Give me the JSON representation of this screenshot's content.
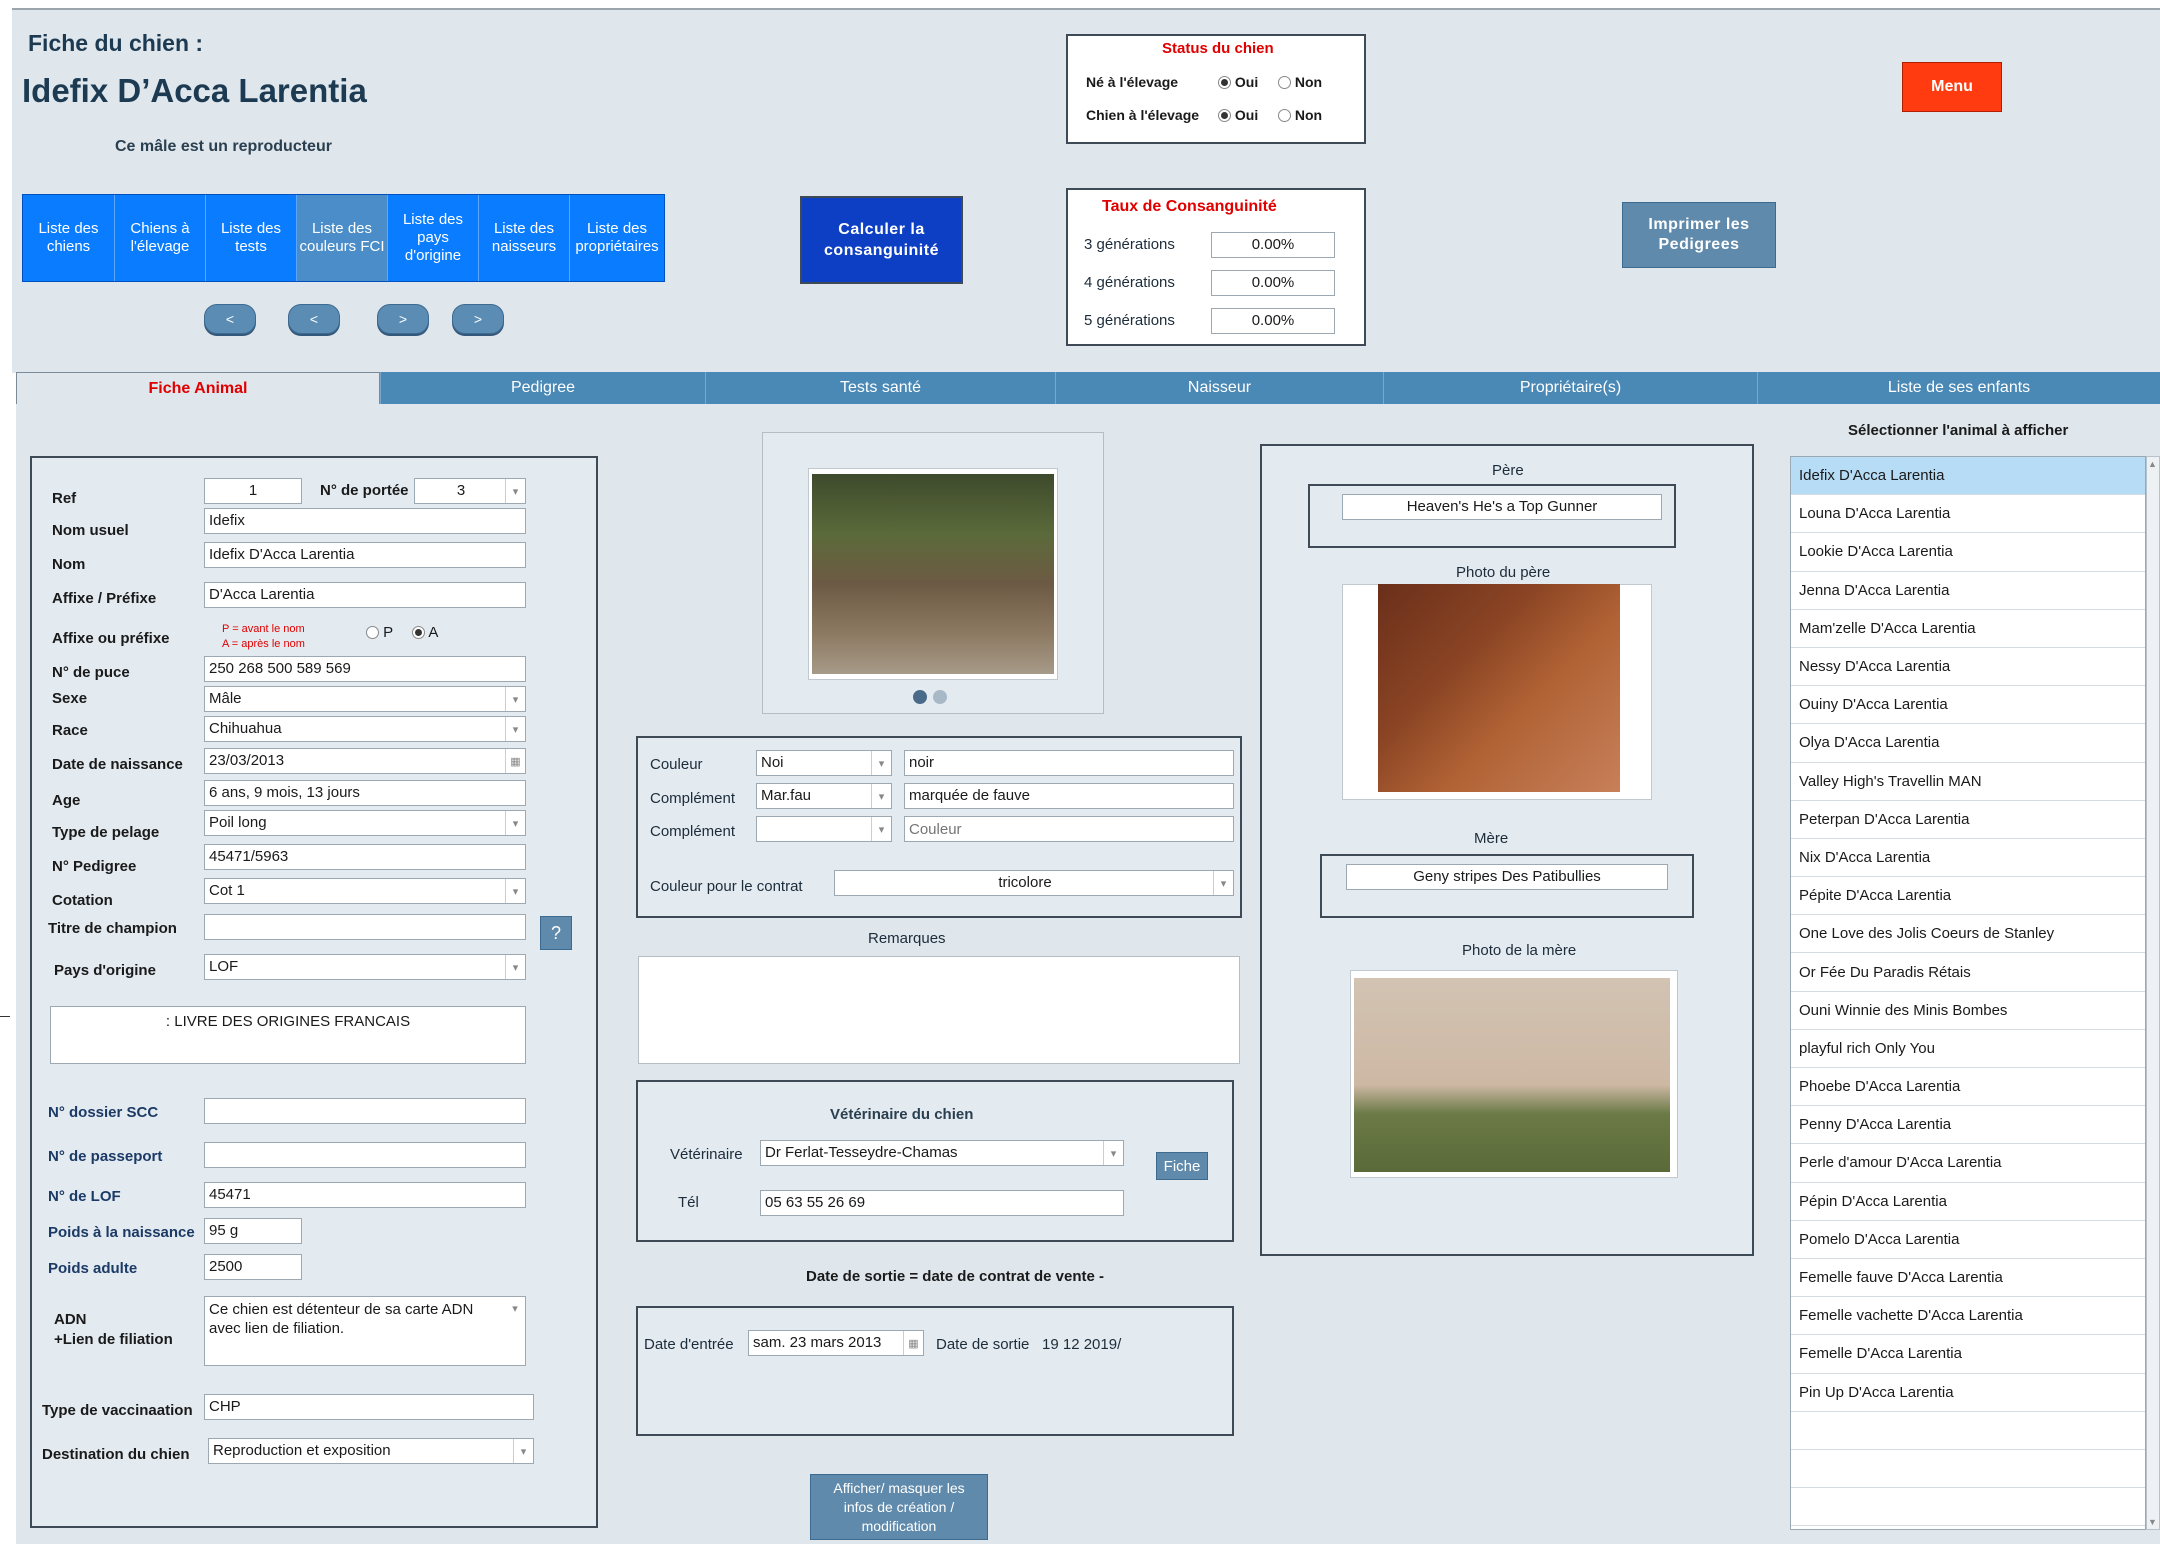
{
  "header": {
    "title": "Fiche du chien :",
    "dog_name": "Idefix  D’Acca Larentia",
    "subtitle": "Ce mâle est un reproducteur",
    "menu_label": "Menu"
  },
  "status": {
    "title": "Status du chien",
    "ne_label": "Né à l'élevage",
    "chien_label": "Chien à l'élevage",
    "oui": "Oui",
    "non": "Non"
  },
  "nav_buttons": [
    "Liste des chiens",
    "Chiens à l'élevage",
    "Liste des tests",
    "Liste des couleurs FCI",
    "Liste des pays d'origine",
    "Liste des naisseurs",
    "Liste des propriétaires"
  ],
  "nav_arrows": [
    "<",
    "<",
    ">",
    ">"
  ],
  "calc_button": "Calculer la consanguinité",
  "consanguinite": {
    "title": "Taux de Consanguinité",
    "rows": [
      {
        "label": "3 générations",
        "value": "0.00%"
      },
      {
        "label": "4 générations",
        "value": "0.00%"
      },
      {
        "label": "5 générations",
        "value": "0.00%"
      }
    ]
  },
  "print_button": "Imprimer les Pedigrees",
  "tabs": [
    "Fiche Animal",
    "Pedigree",
    "Tests santé",
    "Naisseur",
    "Propriétaire(s)",
    "Liste de ses enfants"
  ],
  "form": {
    "ref_label": "Ref",
    "ref_value": "1",
    "portee_label": "N° de portée",
    "portee_value": "3",
    "nom_usuel_label": "Nom usuel",
    "nom_usuel_value": "Idefix",
    "nom_label": "Nom",
    "nom_value": "Idefix  D'Acca Larentia",
    "affixe_label": "Affixe / Préfixe",
    "affixe_value": "D'Acca Larentia",
    "affixe_ou_label": "Affixe ou préfixe",
    "affixe_hint1": "P = avant le nom",
    "affixe_hint2": "A = après le nom",
    "opt_p": "P",
    "opt_a": "A",
    "puce_label": "N° de puce",
    "puce_value": "250 268 500 589 569",
    "sexe_label": "Sexe",
    "sexe_value": "Mâle",
    "race_label": "Race",
    "race_value": "Chihuahua",
    "naissance_label": "Date de naissance",
    "naissance_value": "23/03/2013",
    "age_label": "Age",
    "age_value": "6 ans, 9 mois, 13 jours",
    "pelage_label": "Type de pelage",
    "pelage_value": "Poil long",
    "pedigree_label": "N° Pedigree",
    "pedigree_value": "45471/5963",
    "cotation_label": "Cotation",
    "cotation_value": "Cot 1",
    "titre_label": "Titre de champion",
    "titre_value": "",
    "help": "?",
    "pays_label": "Pays d'origine",
    "pays_value": "LOF",
    "pays_desc": ": LIVRE DES ORIGINES FRANCAIS",
    "scc_label": "N° dossier SCC",
    "scc_value": "",
    "passeport_label": "N° de passeport",
    "passeport_value": "",
    "lof_label": "N° de LOF",
    "lof_value": "45471",
    "poids_naiss_label": "Poids à la naissance",
    "poids_naiss_value": "95 g",
    "poids_adulte_label": "Poids adulte",
    "poids_adulte_value": "2500",
    "adn_label1": "ADN",
    "adn_label2": "+Lien de filiation",
    "adn_value": "Ce chien est détenteur de sa carte ADN avec lien de filiation.",
    "vaccination_label": "Type de vaccinaation",
    "vaccination_value": "CHP",
    "destination_label": "Destination du chien",
    "destination_value": "Reproduction et exposition"
  },
  "couleur": {
    "couleur_label": "Couleur",
    "couleur_code": "Noi",
    "couleur_value": "noir",
    "complement_label": "Complément",
    "complement_code": "Mar.fau",
    "complement_value": "marquée de fauve",
    "complement2_label": "Complément",
    "complement2_code": "",
    "complement2_placeholder": "Couleur",
    "contrat_label": "Couleur pour le contrat",
    "contrat_value": "tricolore"
  },
  "remarques_label": "Remarques",
  "veterinaire": {
    "title": "Vétérinaire du chien",
    "vet_label": "Vétérinaire",
    "vet_value": "Dr Ferlat-Tesseydre-Chamas",
    "fiche_button": "Fiche",
    "tel_label": "Tél",
    "tel_value": "05 63 55 26 69"
  },
  "sortie_note": "Date de sortie = date de contrat de vente -",
  "dates": {
    "entree_label": "Date d'entrée",
    "entree_value": "sam. 23 mars 2013",
    "sortie_label": "Date de sortie",
    "sortie_value": "19 12 2019/"
  },
  "toggle_info_button": "Afficher/ masquer les infos de création / modification",
  "parents": {
    "pere_label": "Père",
    "pere_value": "Heaven's  He's a Top Gunner",
    "photo_pere_label": "Photo du père",
    "mere_label": "Mère",
    "mere_value": "Geny stripes   Des Patibullies",
    "photo_mere_label": "Photo de la mère"
  },
  "children": {
    "title": "Sélectionner l'animal à afficher",
    "items": [
      "Idefix  D'Acca Larentia",
      "Louna  D'Acca Larentia",
      "Lookie   D'Acca Larentia",
      "Jenna  D'Acca Larentia",
      "Mam'zelle   D'Acca Larentia",
      "Nessy   D'Acca Larentia",
      "Ouiny   D'Acca Larentia",
      "Olya  D'Acca Larentia",
      "Valley High's   Travellin MAN",
      "Peterpan  D'Acca Larentia",
      "Nix  D'Acca Larentia",
      "Pépite   D'Acca Larentia",
      "One Love  des Jolis Coeurs de Stanley",
      "Or Fée  Du Paradis Rétais",
      "Ouni Winnie   des Minis Bombes",
      "playful rich  Only You",
      "Phoebe  D'Acca Larentia",
      "Penny  D'Acca Larentia",
      "Perle d'amour  D'Acca Larentia",
      "Pépin  D'Acca Larentia",
      "Pomelo  D'Acca Larentia",
      "Femelle fauve  D'Acca Larentia",
      "Femelle vachette  D'Acca Larentia",
      "Femelle  D'Acca Larentia",
      "Pin Up  D'Acca Larentia",
      "",
      "",
      ""
    ]
  }
}
